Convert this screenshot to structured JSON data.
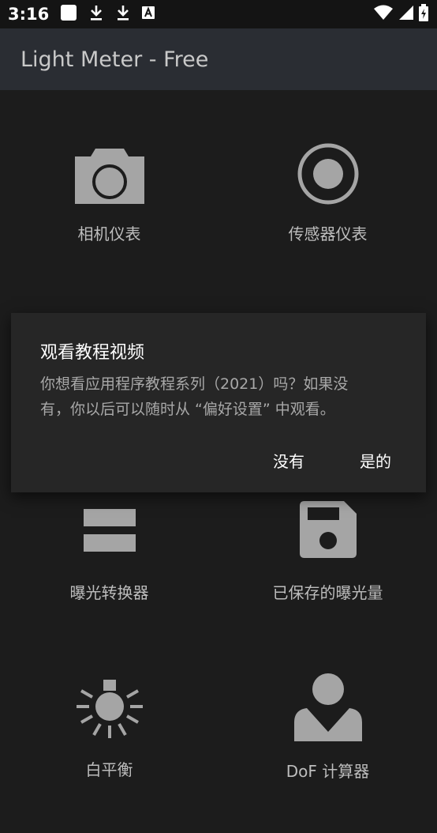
{
  "status_bar": {
    "time": "3:16",
    "icons": [
      "notification-square-icon",
      "download-icon",
      "download-icon",
      "font-a-icon"
    ],
    "right_icons": [
      "wifi-icon",
      "signal-icon",
      "battery-charging-icon"
    ]
  },
  "app_bar": {
    "title": "Light Meter - Free"
  },
  "tiles": [
    {
      "label": "相机仪表",
      "icon": "camera-icon"
    },
    {
      "label": "传感器仪表",
      "icon": "sensor-icon"
    },
    {
      "label": "曝光转换器",
      "icon": "equals-icon"
    },
    {
      "label": "已保存的曝光量",
      "icon": "save-icon"
    },
    {
      "label": "白平衡",
      "icon": "white-balance-icon"
    },
    {
      "label": "DoF 计算器",
      "icon": "person-icon"
    }
  ],
  "dialog": {
    "title": "观看教程视频",
    "message_line1": "你想看应用程序教程系列（2021）吗？如果没",
    "message_line2": "有，你以后可以随时从 “偏好设置” 中观看。",
    "negative": "没有",
    "positive": "是的"
  },
  "colors": {
    "background": "#1c1c1c",
    "app_bar": "#2a2d33",
    "dialog": "#262626",
    "icon": "#a5a5a5"
  }
}
